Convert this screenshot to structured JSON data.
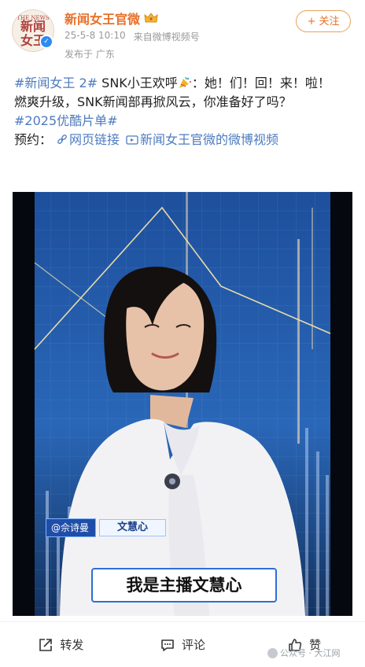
{
  "header": {
    "avatar_top_text": "THE NEWS",
    "avatar_text": "新闻女王",
    "username": "新闻女王官微",
    "date": "25-5-8 10:10",
    "source": "来自微博视频号",
    "location": "发布于 广东",
    "follow_label": "+ 关注"
  },
  "post": {
    "hashtag1": "#新闻女王 2#",
    "line1_text": " SNK小王欢呼",
    "line1_end": "：她！们！回！来！啦！",
    "line2": "燃爽升级，SNK新闻部再掀风云，你准备好了吗？",
    "hashtag2": "#2025优酷片单#",
    "reserve_label": "预约：",
    "link_web": "网页链接",
    "link_video": "新闻女王官微的微博视频"
  },
  "video": {
    "handle": "@佘诗曼",
    "role": "文慧心",
    "subtitle": "我是主播文慧心"
  },
  "actions": {
    "repost": "转发",
    "comment": "评论",
    "like": "赞"
  },
  "watermark": "公众号 · 大江网"
}
